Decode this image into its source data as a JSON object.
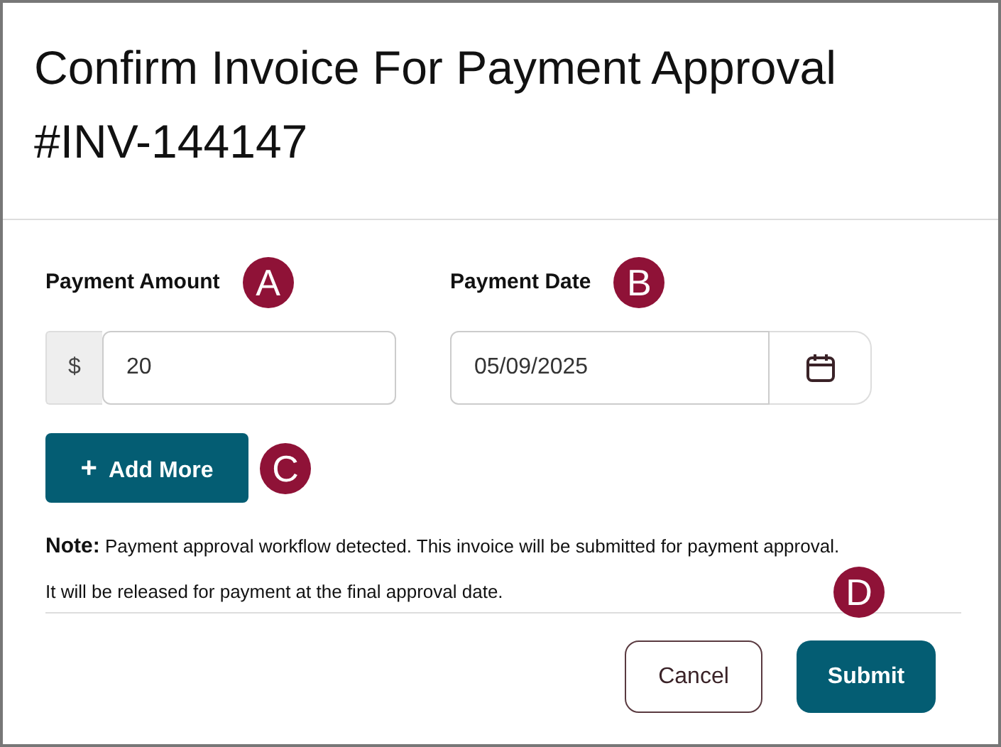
{
  "dialog": {
    "title": "Confirm Invoice For Payment Approval #INV-144147"
  },
  "amount": {
    "label": "Payment Amount",
    "callout": "A",
    "prefix": "$",
    "value": "20"
  },
  "date": {
    "label": "Payment Date",
    "callout": "B",
    "value": "05/09/2025"
  },
  "add_button": {
    "label": "Add More",
    "icon": "+",
    "callout": "C"
  },
  "note": [
    "**Note:** Payment approval workflow detected. This invoice will be submitted for payment approval.",
    "It will be released for payment at the final approval date."
  ],
  "footer": {
    "buttons": [
      {
        "label": "Cancel",
        "kind": "secondary"
      },
      {
        "label": "Submit",
        "kind": "primary",
        "callout": "D"
      }
    ]
  }
}
